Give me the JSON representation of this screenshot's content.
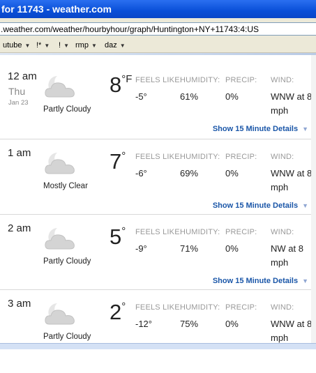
{
  "window": {
    "title": "for 11743 - weather.com"
  },
  "address_bar": {
    "url": ".weather.com/weather/hourbyhour/graph/Huntington+NY+11743:4:US"
  },
  "bookmarks": [
    {
      "label": "utube"
    },
    {
      "label": "!*"
    },
    {
      "label": "!"
    },
    {
      "label": "rmp"
    },
    {
      "label": "daz"
    }
  ],
  "labels": {
    "feels_like": "FEELS LIKE:",
    "humidity": "HUMIDITY:",
    "precip": "PRECIP:",
    "wind": "WIND:",
    "details": "Show 15 Minute Details"
  },
  "hours": [
    {
      "time": "12 am",
      "day": "Thu",
      "date": "Jan 23",
      "condition": "Partly Cloudy",
      "temp": "8",
      "unit": "°F",
      "feels_like": "-5°",
      "humidity": "61%",
      "precip": "0%",
      "wind": "WNW at 8 mph"
    },
    {
      "time": "1 am",
      "day": "",
      "date": "",
      "condition": "Mostly Clear",
      "temp": "7",
      "unit": "°",
      "feels_like": "-6°",
      "humidity": "69%",
      "precip": "0%",
      "wind": "WNW at 8 mph"
    },
    {
      "time": "2 am",
      "day": "",
      "date": "",
      "condition": "Partly Cloudy",
      "temp": "5",
      "unit": "°",
      "feels_like": "-9°",
      "humidity": "71%",
      "precip": "0%",
      "wind": "NW at 8 mph"
    },
    {
      "time": "3 am",
      "day": "",
      "date": "",
      "condition": "Partly Cloudy",
      "temp": "2",
      "unit": "°",
      "feels_like": "-12°",
      "humidity": "75%",
      "precip": "0%",
      "wind": "WNW at 8 mph"
    }
  ]
}
